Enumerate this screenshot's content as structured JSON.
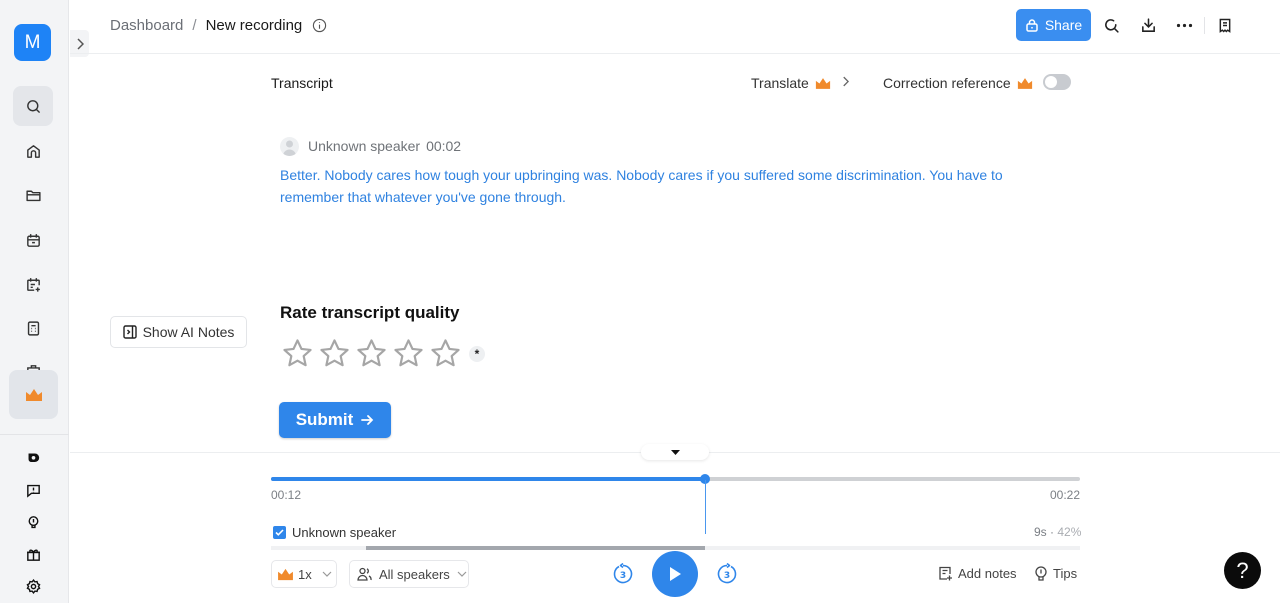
{
  "app": {
    "logo_letter": "M",
    "brand_color": "#1e83f6",
    "accent_color": "#2f86ea",
    "premium_color": "#f08a2c"
  },
  "sidebar": {
    "top_items": [
      {
        "name": "search",
        "icon": "search-icon",
        "active": true
      },
      {
        "name": "home",
        "icon": "home-icon"
      },
      {
        "name": "files",
        "icon": "folder-icon"
      },
      {
        "name": "calendar",
        "icon": "calendar-icon"
      },
      {
        "name": "schedule",
        "icon": "calendar-add-icon"
      },
      {
        "name": "calculator",
        "icon": "calculator-icon"
      },
      {
        "name": "more",
        "icon": "briefcase-icon"
      }
    ],
    "upgrade_icon": "crown-icon",
    "bottom_items": [
      {
        "name": "app",
        "icon": "app-logo-icon"
      },
      {
        "name": "feedback",
        "icon": "feedback-icon"
      },
      {
        "name": "ideas",
        "icon": "lightbulb-icon"
      },
      {
        "name": "gift",
        "icon": "gift-icon"
      },
      {
        "name": "settings",
        "icon": "gear-icon"
      }
    ]
  },
  "header": {
    "breadcrumb_root": "Dashboard",
    "breadcrumb_separator": "/",
    "breadcrumb_current": "New recording",
    "share_label": "Share"
  },
  "transcript": {
    "title": "Transcript",
    "translate_label": "Translate",
    "correction_label": "Correction reference",
    "correction_enabled": false,
    "segments": [
      {
        "speaker": "Unknown speaker",
        "timestamp": "00:02",
        "text": "Better. Nobody cares how tough your upbringing was. Nobody cares if you suffered some discrimination. You have to remember that whatever you've gone through."
      }
    ]
  },
  "ai_notes": {
    "label": "Show AI Notes"
  },
  "rating": {
    "title": "Rate transcript quality",
    "max_stars": 5,
    "selected_stars": 0,
    "required_mark": "*",
    "submit_label": "Submit"
  },
  "player": {
    "current_time": "00:12",
    "total_time": "00:22",
    "progress_fraction": 0.537,
    "speakers": [
      {
        "name": "Unknown speaker",
        "checked": true,
        "duration": "9s",
        "separator": " · ",
        "percent": "42%",
        "segment_start_fraction": 0.117,
        "segment_end_fraction": 0.537
      }
    ],
    "speed_label": "1x",
    "speakers_filter_label": "All speakers",
    "skip_back_seconds": "3",
    "skip_forward_seconds": "3",
    "add_notes_label": "Add notes",
    "tips_label": "Tips"
  },
  "help": {
    "label": "?"
  }
}
